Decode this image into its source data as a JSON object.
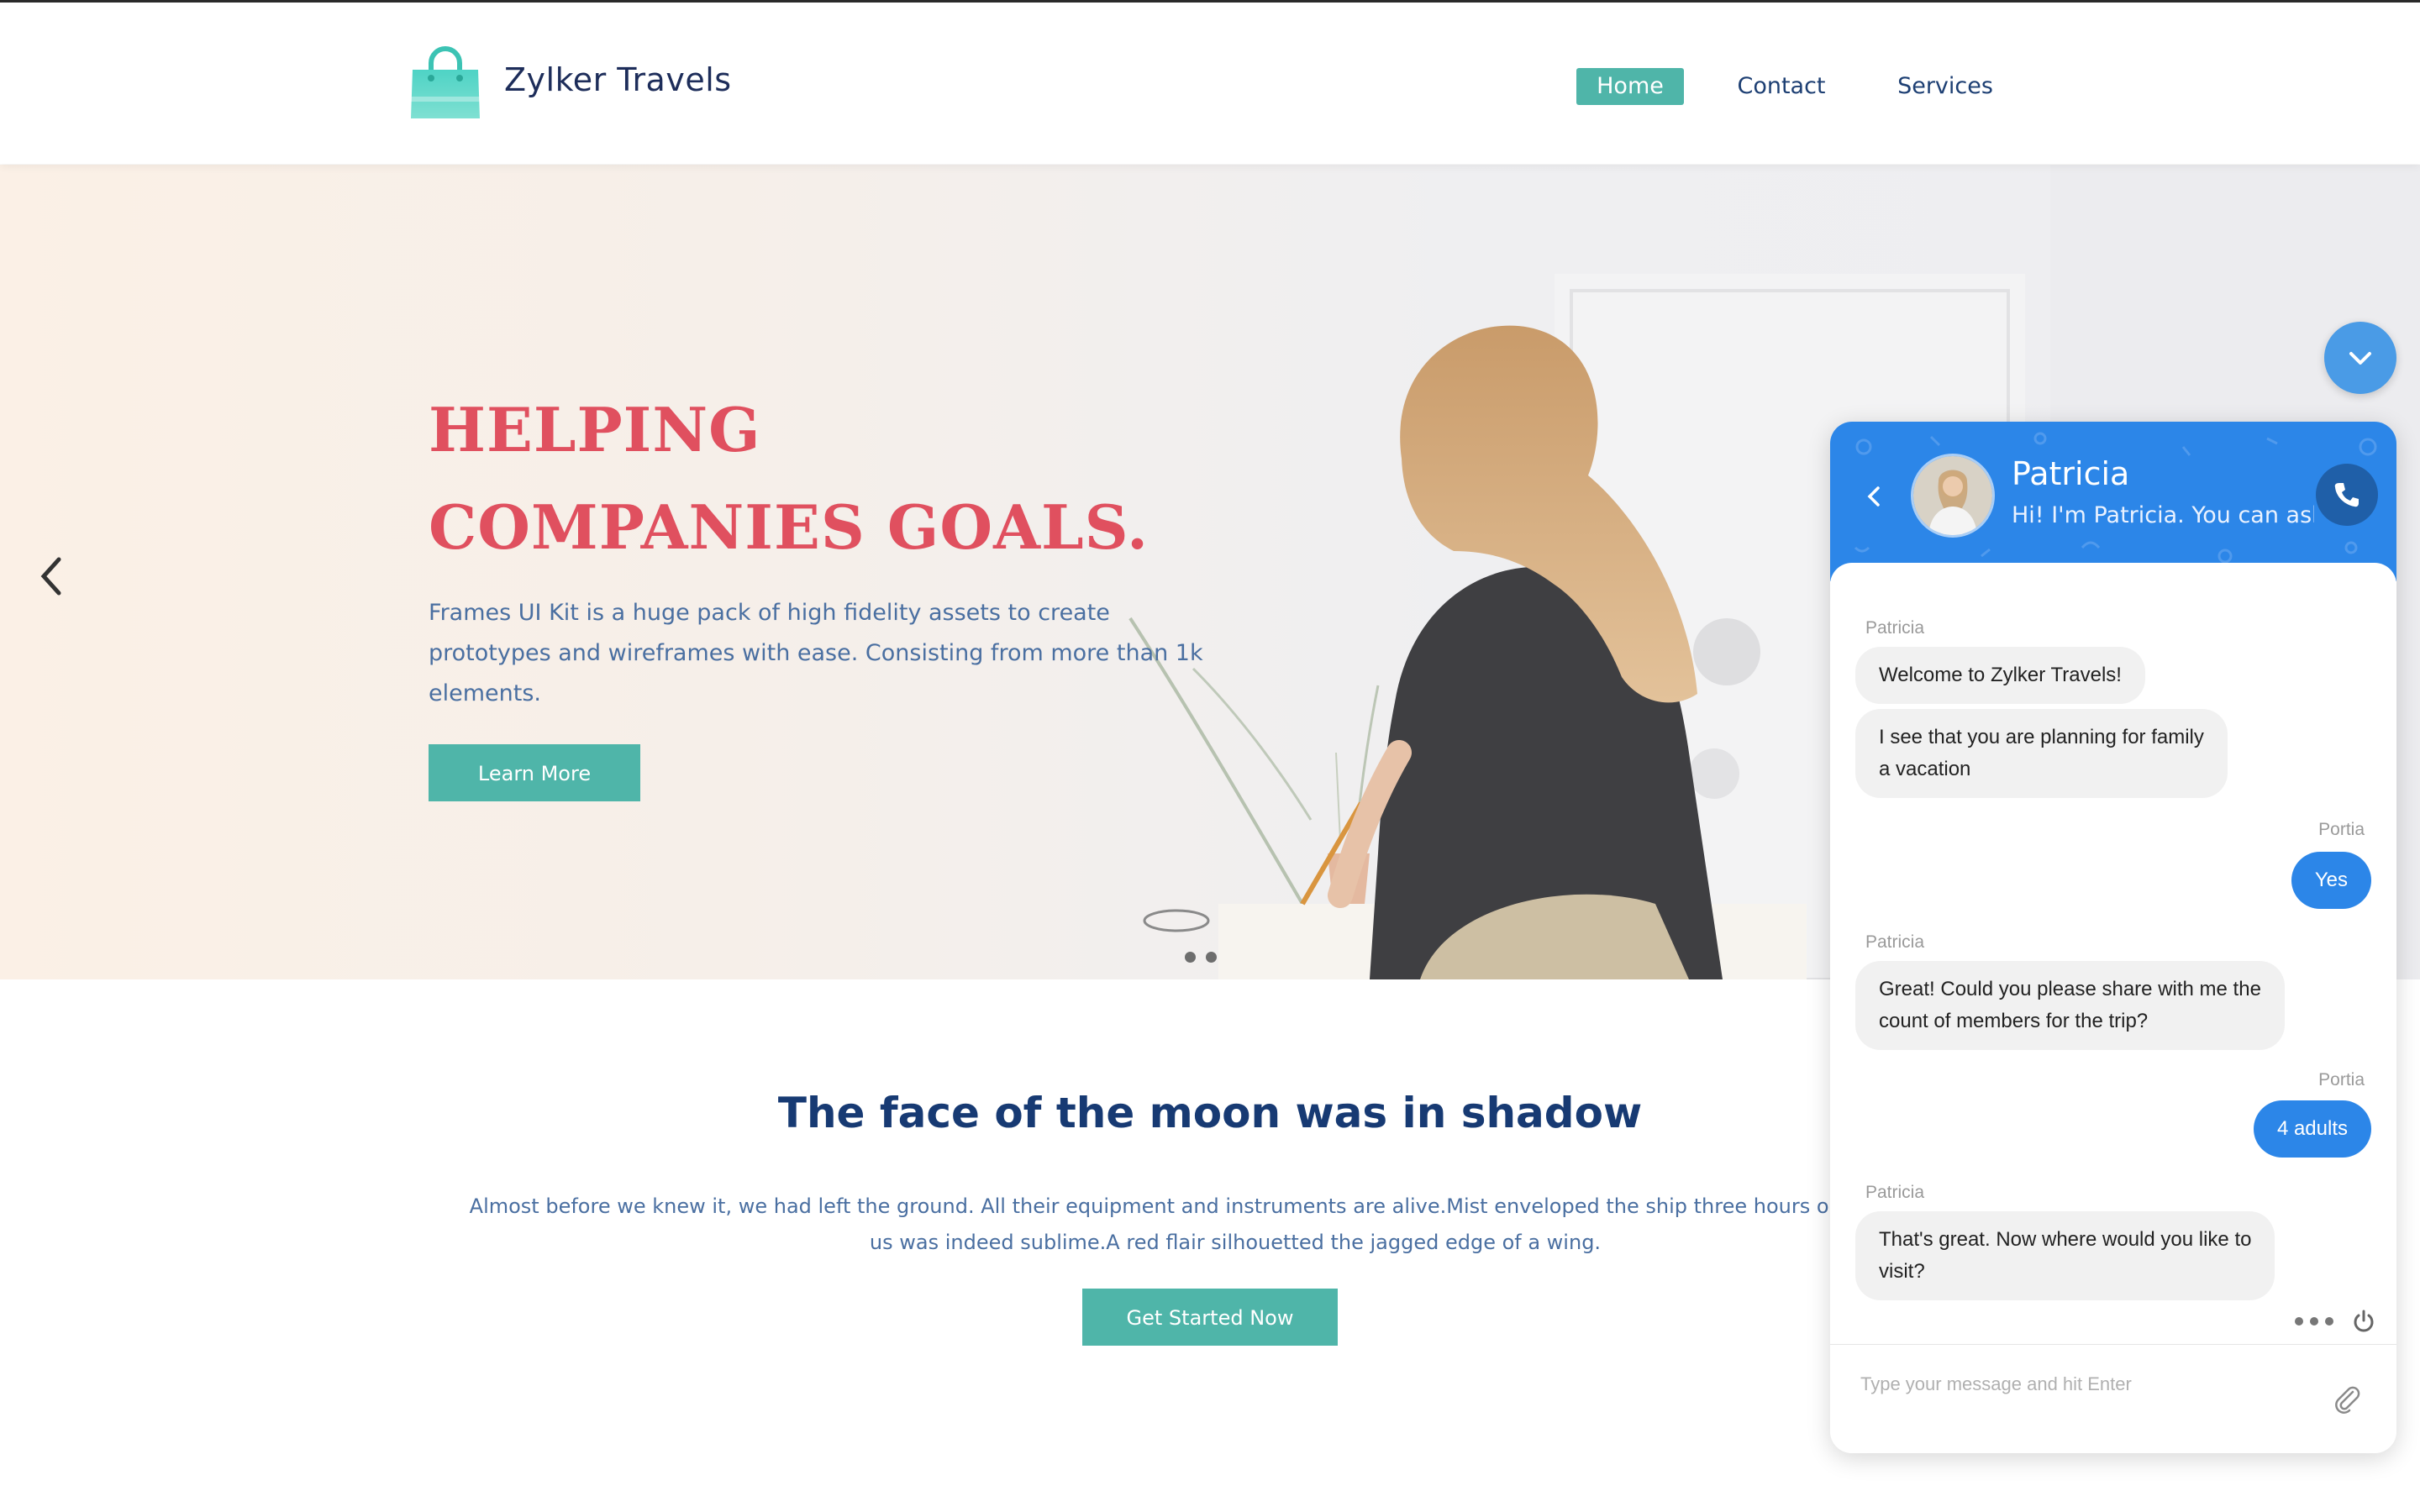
{
  "header": {
    "brand": "Zylker Travels",
    "nav": [
      {
        "label": "Home",
        "active": true
      },
      {
        "label": "Contact"
      },
      {
        "label": "Services"
      }
    ]
  },
  "hero": {
    "title_line1": "HELPING",
    "title_line2": "COMPANIES GOALS.",
    "description": "Frames UI Kit is a huge pack of high fidelity assets to create prototypes and wireframes with ease. Consisting from more than 1k elements.",
    "cta_label": "Learn More",
    "carousel_dots": 2
  },
  "section": {
    "title": "The face of the moon was in shadow",
    "text_line1": "Almost before we knew it, we had left the ground. All their equipment and instruments are alive.Mist enveloped the ship three hours out from port. The",
    "text_line2": "us was indeed sublime.A red flair silhouetted the jagged edge of a wing.",
    "cta_label": "Get Started Now"
  },
  "chat": {
    "agent_name": "Patricia",
    "agent_status": "Hi! I'm Patricia. You can ask...",
    "messages": [
      {
        "sender": "Patricia",
        "text": "Welcome to Zylker Travels!"
      },
      {
        "sender": "",
        "text_line1": "I see that you are planning for family",
        "text_line2": "a vacation"
      },
      {
        "sender": "Portia",
        "text": "Yes"
      },
      {
        "sender": "Patricia",
        "text_line1": "Great! Could you please share with me the",
        "text_line2": "count of members for the trip?"
      },
      {
        "sender": "Portia",
        "text": "4 adults"
      },
      {
        "sender": "Patricia",
        "text_line1": "That's great. Now where would you like to",
        "text_line2": "visit?"
      }
    ],
    "input_placeholder": "Type your message and hit Enter"
  },
  "icons": [
    "shopping-bag-logo-icon",
    "chevron-left-icon",
    "chevron-down-icon",
    "phone-icon",
    "more-dots-icon",
    "power-icon",
    "paperclip-icon"
  ],
  "colors": {
    "accent_teal": "#4fb5a9",
    "title_red": "#e0505f",
    "navy": "#173a73",
    "chat_blue": "#2c86e8"
  }
}
